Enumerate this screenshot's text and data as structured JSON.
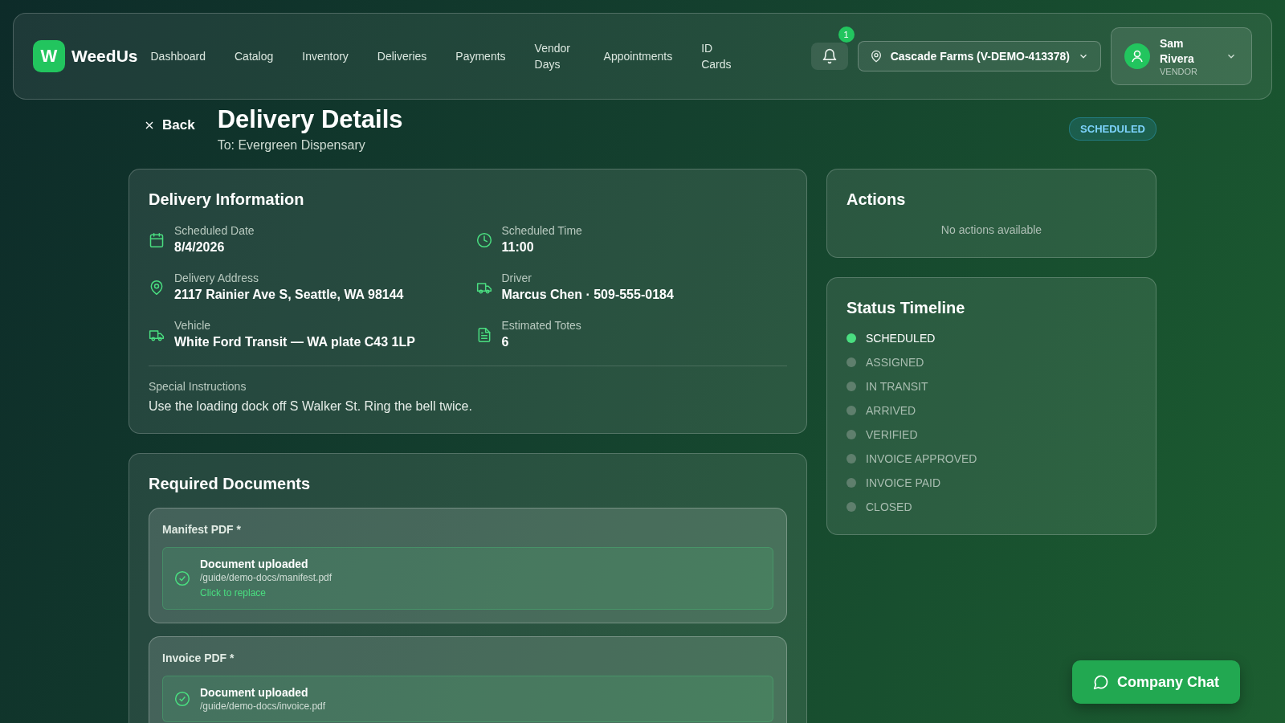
{
  "nav": {
    "logo_letter": "W",
    "brand": "WeedUs",
    "items": [
      {
        "label": "Dashboard",
        "selected": false
      },
      {
        "label": "Catalog",
        "selected": false
      },
      {
        "label": "Inventory",
        "selected": false
      },
      {
        "label": "Deliveries",
        "selected": false
      },
      {
        "label": "Payments",
        "selected": false
      },
      {
        "label": "Vendor Days",
        "selected": false
      },
      {
        "label": "Appointments",
        "selected": false
      },
      {
        "label": "ID Cards",
        "selected": false
      }
    ],
    "notification_count": "1",
    "location": "Cascade Farms (V-DEMO-413378)",
    "user": {
      "name": "Sam Rivera",
      "role": "VENDOR"
    }
  },
  "header": {
    "back": "Back",
    "title": "Delivery Details",
    "subtitle": "To: Evergreen Dispensary",
    "status": "SCHEDULED"
  },
  "delivery_info": {
    "title": "Delivery Information",
    "fields": [
      {
        "kind": "calendar",
        "label": "Scheduled Date",
        "value": "8/4/2026"
      },
      {
        "kind": "clock",
        "label": "Scheduled Time",
        "value": "11:00"
      },
      {
        "kind": "pin",
        "label": "Delivery Address",
        "value": "2117 Rainier Ave S, Seattle, WA 98144"
      },
      {
        "kind": "truck",
        "label": "Driver",
        "value": "Marcus Chen · 509-555-0184"
      },
      {
        "kind": "truck",
        "label": "Vehicle",
        "value": "White Ford Transit — WA plate C43 1LP"
      },
      {
        "kind": "document",
        "label": "Estimated Totes",
        "value": "6"
      }
    ],
    "instructions_label": "Special Instructions",
    "instructions": "Use the loading dock off S Walker St. Ring the bell twice."
  },
  "actions": {
    "title": "Actions",
    "empty": "No actions available"
  },
  "timeline": {
    "title": "Status Timeline",
    "steps": [
      {
        "label": "SCHEDULED",
        "selected": true
      },
      {
        "label": "ASSIGNED",
        "selected": false
      },
      {
        "label": "IN TRANSIT",
        "selected": false
      },
      {
        "label": "ARRIVED",
        "selected": false
      },
      {
        "label": "VERIFIED",
        "selected": false
      },
      {
        "label": "INVOICE APPROVED",
        "selected": false
      },
      {
        "label": "INVOICE PAID",
        "selected": false
      },
      {
        "label": "CLOSED",
        "selected": false
      }
    ]
  },
  "documents": {
    "title": "Required Documents",
    "items": [
      {
        "label": "Manifest PDF *",
        "status": "Document uploaded",
        "path": "/guide/demo-docs/manifest.pdf",
        "action": "Click to replace"
      },
      {
        "label": "Invoice PDF *",
        "status": "Document uploaded",
        "path": "/guide/demo-docs/invoice.pdf"
      }
    ]
  },
  "chat_button": "Company Chat"
}
